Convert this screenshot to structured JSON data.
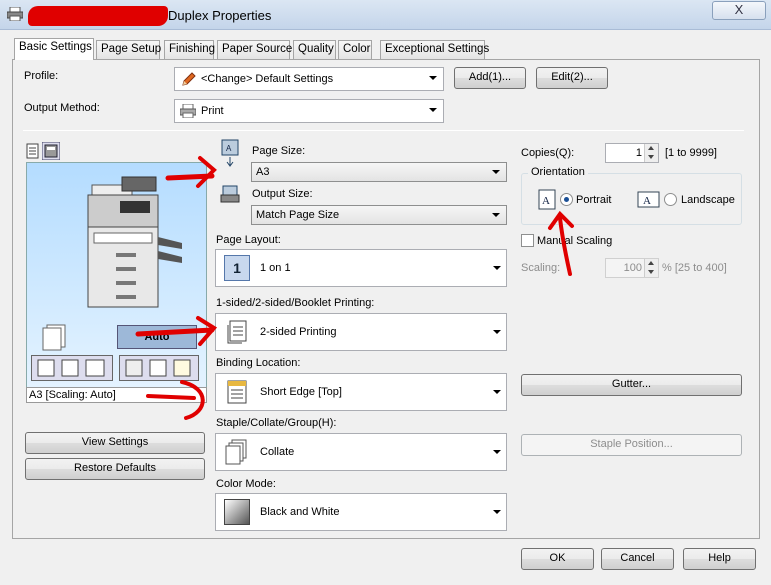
{
  "window": {
    "title": "Duplex Properties",
    "close_label": "X"
  },
  "tabs": [
    {
      "label": "Basic Settings",
      "active": true
    },
    {
      "label": "Page Setup"
    },
    {
      "label": "Finishing"
    },
    {
      "label": "Paper Source"
    },
    {
      "label": "Quality"
    },
    {
      "label": "Color"
    },
    {
      "label": "Exceptional Settings"
    }
  ],
  "profile": {
    "label": "Profile:",
    "value": "<Change> Default Settings",
    "add_label": "Add(1)...",
    "edit_label": "Edit(2)..."
  },
  "output_method": {
    "label": "Output Method:",
    "value": "Print"
  },
  "preview": {
    "scaling_label": "Auto",
    "status": "A3 [Scaling: Auto]",
    "view_settings_label": "View Settings",
    "restore_defaults_label": "Restore Defaults"
  },
  "page_size": {
    "label": "Page Size:",
    "value": "A3"
  },
  "output_size": {
    "label": "Output Size:",
    "value": "Match Page Size"
  },
  "page_layout": {
    "label": "Page Layout:",
    "value": "1 on 1",
    "icon_text": "1"
  },
  "sided": {
    "label": "1-sided/2-sided/Booklet Printing:",
    "value": "2-sided Printing"
  },
  "binding": {
    "label": "Binding Location:",
    "value": "Short Edge [Top]"
  },
  "staple": {
    "label": "Staple/Collate/Group(H):",
    "value": "Collate"
  },
  "color_mode": {
    "label": "Color Mode:",
    "value": "Black and White"
  },
  "copies": {
    "label": "Copies(Q):",
    "value": "1",
    "range": "[1 to 9999]"
  },
  "orientation": {
    "title": "Orientation",
    "portrait_label": "Portrait",
    "landscape_label": "Landscape",
    "selected": "portrait"
  },
  "manual_scaling": {
    "label": "Manual Scaling",
    "checked": false
  },
  "scaling": {
    "label": "Scaling:",
    "value": "100",
    "range": "% [25 to 400]"
  },
  "gutter_label": "Gutter...",
  "staple_position_label": "Staple Position...",
  "footer": {
    "ok": "OK",
    "cancel": "Cancel",
    "help": "Help"
  },
  "colors": {
    "annotation_red": "#e00000",
    "preview_bg": "#b4dcff",
    "accent": "#1a4f95"
  }
}
